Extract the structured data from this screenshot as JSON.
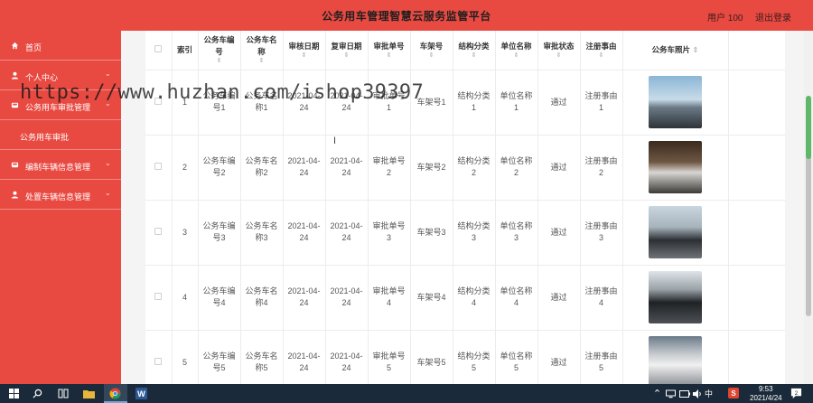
{
  "header": {
    "title": "公务用车管理智慧云服务监管平台",
    "user_label": "用户 100",
    "logout_label": "退出登录"
  },
  "sidebar": {
    "items": [
      {
        "icon": "home-icon",
        "label": "首页",
        "has_chevron": false
      },
      {
        "icon": "user-icon",
        "label": "个人中心",
        "has_chevron": true
      },
      {
        "icon": "car-icon",
        "label": "公务用车审批管理",
        "has_chevron": true
      },
      {
        "icon": "",
        "label": "公务用车审批",
        "sub": true
      },
      {
        "icon": "car-icon",
        "label": "编制车辆信息管理",
        "has_chevron": true
      },
      {
        "icon": "user-icon",
        "label": "处置车辆信息管理",
        "has_chevron": true
      }
    ]
  },
  "table": {
    "columns": [
      "索引",
      "公务车编号",
      "公务车名称",
      "审核日期",
      "复审日期",
      "审批单号",
      "车架号",
      "结构分类",
      "单位名称",
      "审批状态",
      "注册事由",
      "公务车照片"
    ],
    "rows": [
      {
        "index": "1",
        "code": "公务车编号1",
        "name": "公务车名称1",
        "review_date": "2021-04-24",
        "recheck_date": "2021-04-24",
        "approval_no": "审批单号1",
        "frame_no": "车架号1",
        "category": "结构分类1",
        "unit": "单位名称1",
        "status": "通过",
        "reason": "注册事由1"
      },
      {
        "index": "2",
        "code": "公务车编号2",
        "name": "公务车名称2",
        "review_date": "2021-04-24",
        "recheck_date": "2021-04-24",
        "approval_no": "审批单号2",
        "frame_no": "车架号2",
        "category": "结构分类2",
        "unit": "单位名称2",
        "status": "通过",
        "reason": "注册事由2"
      },
      {
        "index": "3",
        "code": "公务车编号3",
        "name": "公务车名称3",
        "review_date": "2021-04-24",
        "recheck_date": "2021-04-24",
        "approval_no": "审批单号3",
        "frame_no": "车架号3",
        "category": "结构分类3",
        "unit": "单位名称3",
        "status": "通过",
        "reason": "注册事由3"
      },
      {
        "index": "4",
        "code": "公务车编号4",
        "name": "公务车名称4",
        "review_date": "2021-04-24",
        "recheck_date": "2021-04-24",
        "approval_no": "审批单号4",
        "frame_no": "车架号4",
        "category": "结构分类4",
        "unit": "单位名称4",
        "status": "通过",
        "reason": "注册事由4"
      },
      {
        "index": "5",
        "code": "公务车编号5",
        "name": "公务车名称5",
        "review_date": "2021-04-24",
        "recheck_date": "2021-04-24",
        "approval_no": "审批单号5",
        "frame_no": "车架号5",
        "category": "结构分类5",
        "unit": "单位名称5",
        "status": "通过",
        "reason": "注册事由5"
      }
    ]
  },
  "watermark": "https://www.huzhan.com/ishop39397",
  "taskbar": {
    "ime": "中",
    "badge": "S",
    "time": "9:53",
    "date": "2021/4/24",
    "notifications": "2"
  },
  "colors": {
    "brand_red": "#e84a42",
    "taskbar": "#1b2a3a"
  }
}
